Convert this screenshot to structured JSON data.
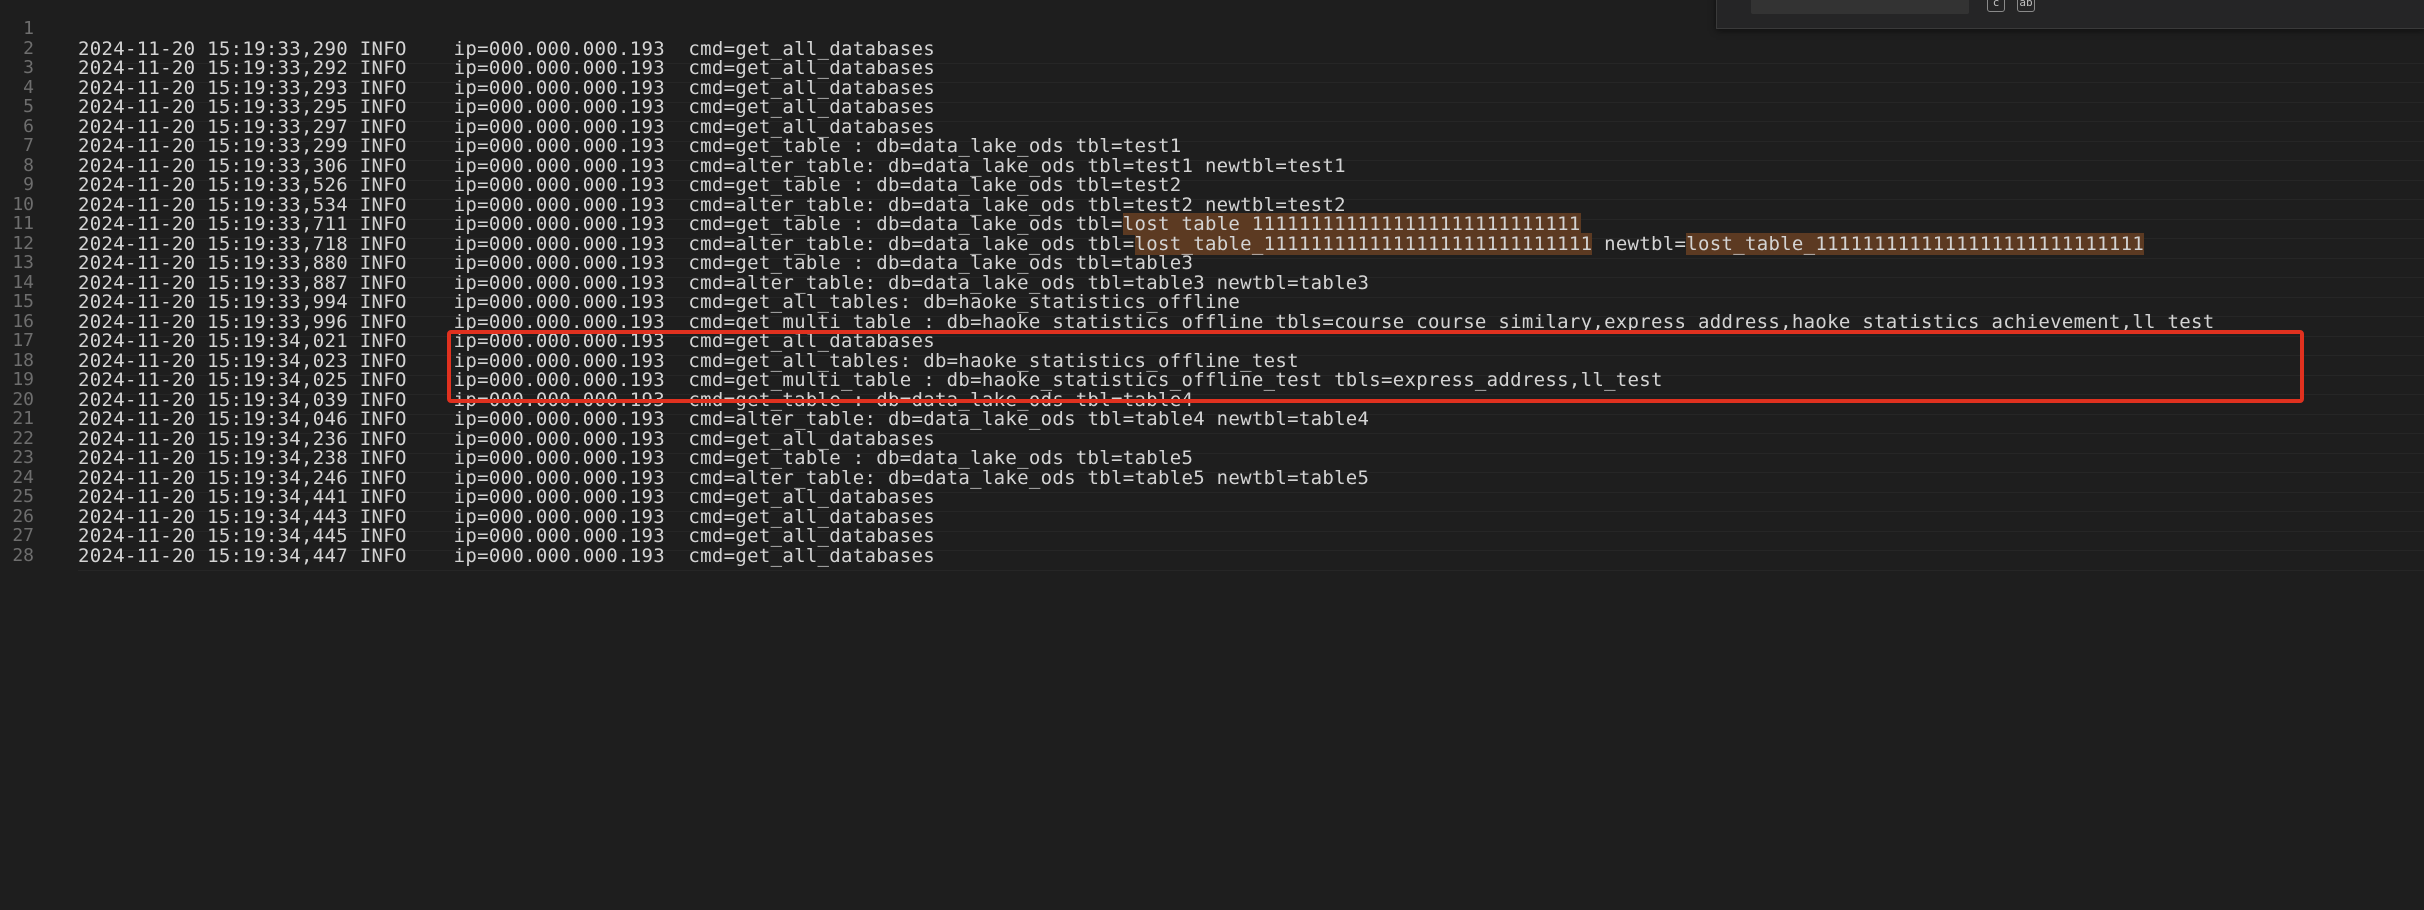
{
  "lines": [
    {
      "number": "1",
      "text": ""
    },
    {
      "number": "2",
      "text": "2024-11-20 15:19:33,290 INFO    ip=000.000.000.193  cmd=get_all_databases"
    },
    {
      "number": "3",
      "text": "2024-11-20 15:19:33,292 INFO    ip=000.000.000.193  cmd=get_all_databases"
    },
    {
      "number": "4",
      "text": "2024-11-20 15:19:33,293 INFO    ip=000.000.000.193  cmd=get_all_databases"
    },
    {
      "number": "5",
      "text": "2024-11-20 15:19:33,295 INFO    ip=000.000.000.193  cmd=get_all_databases"
    },
    {
      "number": "6",
      "text": "2024-11-20 15:19:33,297 INFO    ip=000.000.000.193  cmd=get_all_databases"
    },
    {
      "number": "7",
      "text": "2024-11-20 15:19:33,299 INFO    ip=000.000.000.193  cmd=get_table : db=data_lake_ods tbl=test1"
    },
    {
      "number": "8",
      "text": "2024-11-20 15:19:33,306 INFO    ip=000.000.000.193  cmd=alter_table: db=data_lake_ods tbl=test1 newtbl=test1"
    },
    {
      "number": "9",
      "text": "2024-11-20 15:19:33,526 INFO    ip=000.000.000.193  cmd=get_table : db=data_lake_ods tbl=test2"
    },
    {
      "number": "10",
      "text": "2024-11-20 15:19:33,534 INFO    ip=000.000.000.193  cmd=alter_table: db=data_lake_ods tbl=test2 newtbl=test2"
    },
    {
      "number": "11",
      "segments": [
        {
          "text": "2024-11-20 15:19:33,711 INFO    ip=000.000.000.193  cmd=get_table : db=data_lake_ods tbl=",
          "highlight": false
        },
        {
          "text": "lost_table_1111111111111111111111111111",
          "highlight": true
        }
      ]
    },
    {
      "number": "12",
      "segments": [
        {
          "text": "2024-11-20 15:19:33,718 INFO    ip=000.000.000.193  cmd=alter_table: db=data_lake_ods tbl=",
          "highlight": false
        },
        {
          "text": "lost_table_1111111111111111111111111111",
          "highlight": true
        },
        {
          "text": " newtbl=",
          "highlight": false
        },
        {
          "text": "lost_table_1111111111111111111111111111",
          "highlight": true
        }
      ]
    },
    {
      "number": "13",
      "text": "2024-11-20 15:19:33,880 INFO    ip=000.000.000.193  cmd=get_table : db=data_lake_ods tbl=table3"
    },
    {
      "number": "14",
      "text": "2024-11-20 15:19:33,887 INFO    ip=000.000.000.193  cmd=alter_table: db=data_lake_ods tbl=table3 newtbl=table3"
    },
    {
      "number": "15",
      "text": "2024-11-20 15:19:33,994 INFO    ip=000.000.000.193  cmd=get_all_tables: db=haoke_statistics_offline"
    },
    {
      "number": "16",
      "text": "2024-11-20 15:19:33,996 INFO    ip=000.000.000.193  cmd=get_multi_table : db=haoke_statistics_offline tbls=course_course_similary,express_address,haoke_statistics_achievement,ll_test"
    },
    {
      "number": "17",
      "text": "2024-11-20 15:19:34,021 INFO    ip=000.000.000.193  cmd=get_all_databases"
    },
    {
      "number": "18",
      "text": "2024-11-20 15:19:34,023 INFO    ip=000.000.000.193  cmd=get_all_tables: db=haoke_statistics_offline_test"
    },
    {
      "number": "19",
      "text": "2024-11-20 15:19:34,025 INFO    ip=000.000.000.193  cmd=get_multi_table : db=haoke_statistics_offline_test tbls=express_address,ll_test"
    },
    {
      "number": "20",
      "text": "2024-11-20 15:19:34,039 INFO    ip=000.000.000.193  cmd=get_table : db=data_lake_ods tbl=table4"
    },
    {
      "number": "21",
      "text": "2024-11-20 15:19:34,046 INFO    ip=000.000.000.193  cmd=alter_table: db=data_lake_ods tbl=table4 newtbl=table4"
    },
    {
      "number": "22",
      "text": "2024-11-20 15:19:34,236 INFO    ip=000.000.000.193  cmd=get_all_databases"
    },
    {
      "number": "23",
      "text": "2024-11-20 15:19:34,238 INFO    ip=000.000.000.193  cmd=get_table : db=data_lake_ods tbl=table5"
    },
    {
      "number": "24",
      "text": "2024-11-20 15:19:34,246 INFO    ip=000.000.000.193  cmd=alter_table: db=data_lake_ods tbl=table5 newtbl=table5"
    },
    {
      "number": "25",
      "text": "2024-11-20 15:19:34,441 INFO    ip=000.000.000.193  cmd=get_all_databases"
    },
    {
      "number": "26",
      "text": "2024-11-20 15:19:34,443 INFO    ip=000.000.000.193  cmd=get_all_databases"
    },
    {
      "number": "27",
      "text": "2024-11-20 15:19:34,445 INFO    ip=000.000.000.193  cmd=get_all_databases"
    },
    {
      "number": "28",
      "text": "2024-11-20 15:19:34,447 INFO    ip=000.000.000.193  cmd=get_all_databases"
    }
  ],
  "colors": {
    "background": "#1e1e1e",
    "text": "#d4d4d4",
    "line_number": "#6e6e6e",
    "highlight": "#5c3a22",
    "annotation_box": "#e0311f"
  },
  "find_widget": {
    "icons": [
      "match-case-icon",
      "whole-word-icon"
    ]
  }
}
